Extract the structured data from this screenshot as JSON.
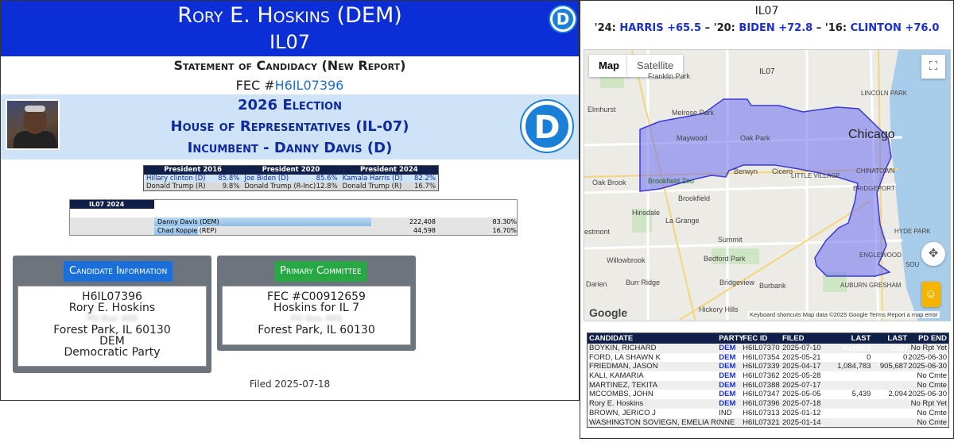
{
  "header": {
    "name": "Rory E. Hoskins (DEM)",
    "district": "IL07",
    "logo_letter": "D"
  },
  "statement": "Statement of Candidacy (New Report)",
  "fec": {
    "label": "FEC #",
    "id": "H6IL07396"
  },
  "election": {
    "title": "2026 Election",
    "office": "House of Representatives (IL-07)",
    "incumbent": "Incumbent - Danny Davis (D)"
  },
  "presidential": {
    "headers": [
      "President 2016",
      "President 2020",
      "President 2024"
    ],
    "rows": [
      [
        [
          "Hillary clinton (D)",
          "85.8%"
        ],
        [
          "Joe Biden (D)",
          "85.6%"
        ],
        [
          "Kamala Harris (D)",
          "82.2%"
        ]
      ],
      [
        [
          "Donald Trump (R)",
          "9.8%"
        ],
        [
          "Donald Trump (R-Inc)",
          "12.8%"
        ],
        [
          "Donald Trump (R)",
          "16.7%"
        ]
      ]
    ]
  },
  "results": {
    "title": "IL07 2024",
    "rows": [
      {
        "name": "Danny Davis (DEM)",
        "votes": "222,408",
        "pct": "83.30%",
        "share": 0.833,
        "color": "#8fbde8"
      },
      {
        "name": "Chad Koppie (REP)",
        "votes": "44,598",
        "pct": "16.70%",
        "share": 0.167,
        "color": "#8fbde8"
      }
    ]
  },
  "candidate_info": {
    "badge": "Candidate Information",
    "lines": [
      "H6IL07396",
      "Rory E. Hoskins",
      "",
      "Forest Park, IL 60130",
      "DEM",
      "Democratic Party"
    ],
    "blurred": "PO Box 489"
  },
  "primary_committee": {
    "badge": "Primary Committee",
    "lines": [
      "FEC #C00912659",
      "Hoskins for IL 7",
      "",
      "Forest Park, IL 60130"
    ],
    "blurred": "PO Box 489"
  },
  "filed": "Filed 2025-07-18",
  "right": {
    "title": "IL07",
    "pres_prefix_24": "'24: ",
    "pres_24": "HARRIS +65.5",
    "pres_prefix_20": " – '20: ",
    "pres_20": "BIDEN +72.8",
    "pres_prefix_16": " – '16: ",
    "pres_16": "CLINTON +76.0"
  },
  "map": {
    "tab_map": "Map",
    "tab_satellite": "Satellite",
    "district_label": "IL07",
    "google": "Google",
    "attribution": "Keyboard shortcuts   Map data ©2025 Google   Terms   Report a map error",
    "labels": {
      "chicago": "Chicago",
      "elmhurst": "Elmhurst",
      "melrose": "Melrose Park",
      "maywood": "Maywood",
      "oakpark": "Oak Park",
      "berwyn": "Berwyn",
      "cicero": "Cicero",
      "littlevillage": "LITTLE VILLAGE",
      "chinatown": "CHINATOWN",
      "bridgeport": "BRIDGEPORT",
      "oakbrook": "Oak Brook",
      "brookfieldzoo": "Brookfield Zoo",
      "brookfield": "Brookfield",
      "hinsdale": "Hinsdale",
      "lagrange": "La Grange",
      "westmont": "estmont",
      "summit": "Summit",
      "bedford": "Bedford Park",
      "willowbrook": "Willowbrook",
      "burrridge": "Burr Ridge",
      "bridgeview": "Bridgeview",
      "burbank": "Burbank",
      "hickory": "Hickory Hills",
      "darien": "Darien",
      "hydepark": "HYDE PARK",
      "englewood": "ENGLEWOOD",
      "auburn": "AUBURN GRESHAM",
      "lincolnpark": "LINCOLN PARK",
      "franklinpark": "Franklin Park",
      "sou": "SOU"
    }
  },
  "candidates": {
    "headers": [
      "CANDIDATE",
      "PARTY",
      "FEC ID",
      "FILED",
      "LAST RAISED",
      "LAST COH",
      "PD END"
    ],
    "rows": [
      [
        "BOYKIN, RICHARD",
        "DEM",
        "H6IL07370",
        "2025-07-10",
        "",
        "",
        "No Rpt Yet"
      ],
      [
        "FORD, LA SHAWN K",
        "DEM",
        "H6IL07354",
        "2025-05-21",
        "0",
        "0",
        "2025-06-30"
      ],
      [
        "FRIEDMAN, JASON",
        "DEM",
        "H6IL07339",
        "2025-04-17",
        "1,084,783",
        "905,687",
        "2025-06-30"
      ],
      [
        "KALI, KAMARIA",
        "DEM",
        "H6IL07362",
        "2025-05-28",
        "",
        "",
        "No Cmte"
      ],
      [
        "MARTINEZ, TEKITA",
        "DEM",
        "H6IL07388",
        "2025-07-17",
        "",
        "",
        "No Cmte"
      ],
      [
        "MCCOMBS, JOHN",
        "DEM",
        "H6IL07347",
        "2025-05-05",
        "5,439",
        "2,094",
        "2025-06-30"
      ],
      [
        "Rory E. Hoskins",
        "DEM",
        "H6IL07396",
        "2025-07-18",
        "",
        "",
        "No Rpt Yet"
      ],
      [
        "BROWN, JERICO J",
        "IND",
        "H6IL07313",
        "2025-01-12",
        "",
        "",
        "No Cmte"
      ],
      [
        "WASHINGTON SOVIEGN, EMELIA ROSIE",
        "NNE",
        "H6IL07321",
        "2025-01-14",
        "",
        "",
        "No Cmte"
      ]
    ]
  },
  "colors": {
    "header_blue": "#0b2ed6",
    "dem_blue": "#1a2fd0",
    "navy": "#0f1f4a",
    "band": "#cfe3f7"
  }
}
